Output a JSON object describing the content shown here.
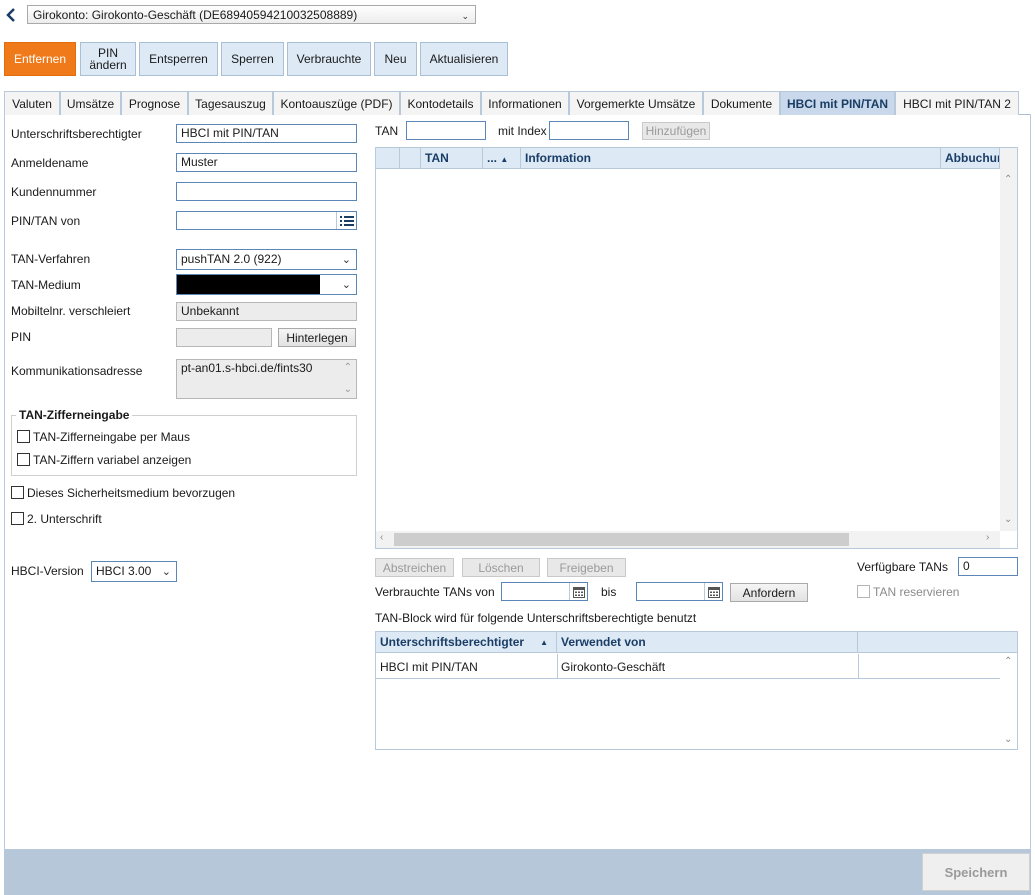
{
  "account": {
    "selected": "Girokonto: Girokonto-Geschäft (DE68940594210032508889)"
  },
  "toolbar": {
    "remove": "Entfernen",
    "pin_change_line1": "PIN",
    "pin_change_line2": "ändern",
    "unlock": "Entsperren",
    "lock": "Sperren",
    "used": "Verbrauchte",
    "new": "Neu",
    "refresh": "Aktualisieren"
  },
  "tabs": [
    {
      "label": "Valuten"
    },
    {
      "label": "Umsätze"
    },
    {
      "label": "Prognose"
    },
    {
      "label": "Tagesauszug"
    },
    {
      "label": "Kontoauszüge (PDF)"
    },
    {
      "label": "Kontodetails"
    },
    {
      "label": "Informationen"
    },
    {
      "label": "Vorgemerkte Umsätze"
    },
    {
      "label": "Dokumente"
    },
    {
      "label": "HBCI mit PIN/TAN"
    },
    {
      "label": "HBCI mit PIN/TAN 2"
    }
  ],
  "form": {
    "signatory_label": "Unterschriftsberechtigter",
    "signatory_value": "HBCI mit PIN/TAN",
    "login_label": "Anmeldename",
    "login_value": "Muster",
    "customer_no_label": "Kundennummer",
    "customer_no_value": "",
    "pintan_from_label": "PIN/TAN von",
    "pintan_from_value": "",
    "tan_method_label": "TAN-Verfahren",
    "tan_method_value": "pushTAN 2.0 (922)",
    "tan_medium_label": "TAN-Medium",
    "mobile_label": "Mobiltelnr. verschleiert",
    "mobile_value": "Unbekannt",
    "pin_label": "PIN",
    "pin_store_button": "Hinterlegen",
    "comm_label": "Kommunikationsadresse",
    "comm_value": "pt-an01.s-hbci.de/fints30",
    "tan_digits_title": "TAN-Zifferneingabe",
    "tan_digits_mouse": "TAN-Zifferneingabe per Maus",
    "tan_digits_variable": "TAN-Ziffern variabel anzeigen",
    "prefer_medium": "Dieses Sicherheitsmedium bevorzugen",
    "second_signature": "2. Unterschrift",
    "hbci_version_label": "HBCI-Version",
    "hbci_version_value": "HBCI 3.00"
  },
  "tan_entry": {
    "tan_label": "TAN",
    "tan_value": "",
    "index_label": "mit Index",
    "index_value": "",
    "add_button": "Hinzufügen"
  },
  "tan_grid": {
    "columns": [
      "TAN",
      "...",
      "Information",
      "Abbuchun"
    ],
    "rows": []
  },
  "tan_actions": {
    "strike": "Abstreichen",
    "delete": "Löschen",
    "release": "Freigeben",
    "available_label": "Verfügbare TANs",
    "available_value": "0",
    "used_from_label": "Verbrauchte TANs von",
    "used_from_value": "",
    "to_label": "bis",
    "to_value": "",
    "request_button": "Anfordern",
    "reserve_label": "TAN reservieren",
    "block_note": "TAN-Block wird für folgende Unterschriftsberechtigte benutzt"
  },
  "signatory_grid": {
    "columns": [
      "Unterschriftsberechtigter",
      "Verwendet von",
      ""
    ],
    "rows": [
      {
        "signatory": "HBCI mit PIN/TAN",
        "used_by": "Girokonto-Geschäft"
      }
    ]
  },
  "footer": {
    "save": "Speichern"
  },
  "colors": {
    "accent_orange": "#f07a1a",
    "tab_active_bg": "#c9d8ea",
    "header_bg": "#dde9f5",
    "footer_bg": "#b6c7da"
  }
}
